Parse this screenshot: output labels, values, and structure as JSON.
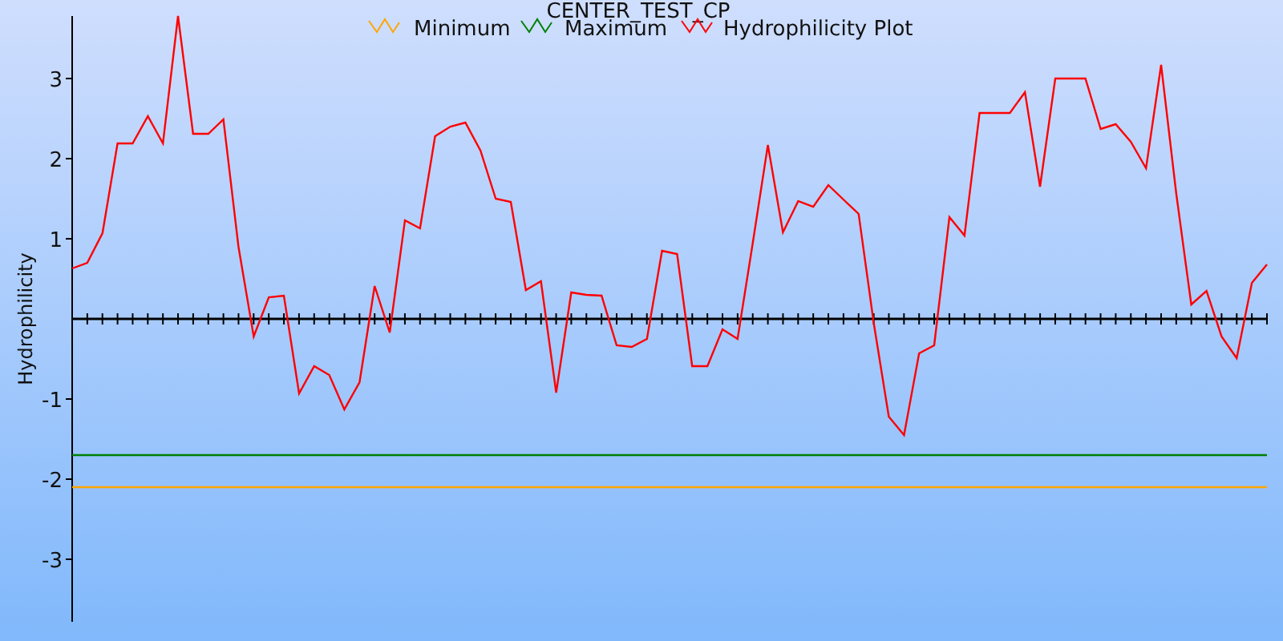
{
  "chart": {
    "chart_data": {
      "type": "line",
      "title": "CENTER_TEST_CP",
      "ylabel": "Hydrophilicity",
      "legend": true,
      "ylim": [
        -3.78,
        3.78
      ],
      "yticks": [
        {
          "value": -3,
          "label": "-3"
        },
        {
          "value": -2,
          "label": "-2"
        },
        {
          "value": -1,
          "label": "-1"
        },
        {
          "value": 1,
          "label": "1"
        },
        {
          "value": 2,
          "label": "2"
        },
        {
          "value": 3,
          "label": "3"
        }
      ],
      "series": [
        {
          "name": "Minimum",
          "color": "#ffa500",
          "values": [
            -2.1,
            -2.1,
            -2.1,
            -2.1,
            -2.1,
            -2.1,
            -2.1,
            -2.1,
            -2.1,
            -2.1,
            -2.1,
            -2.1,
            -2.1,
            -2.1,
            -2.1,
            -2.1,
            -2.1,
            -2.1,
            -2.1,
            -2.1,
            -2.1,
            -2.1,
            -2.1,
            -2.1,
            -2.1,
            -2.1,
            -2.1,
            -2.1,
            -2.1,
            -2.1,
            -2.1,
            -2.1,
            -2.1,
            -2.1,
            -2.1,
            -2.1,
            -2.1,
            -2.1,
            -2.1,
            -2.1,
            -2.1,
            -2.1,
            -2.1,
            -2.1,
            -2.1,
            -2.1,
            -2.1,
            -2.1,
            -2.1,
            -2.1,
            -2.1,
            -2.1,
            -2.1,
            -2.1,
            -2.1,
            -2.1,
            -2.1,
            -2.1,
            -2.1,
            -2.1,
            -2.1,
            -2.1,
            -2.1,
            -2.1,
            -2.1,
            -2.1,
            -2.1,
            -2.1,
            -2.1,
            -2.1,
            -2.1,
            -2.1,
            -2.1,
            -2.1,
            -2.1,
            -2.1,
            -2.1,
            -2.1,
            -2.1,
            -2.1
          ]
        },
        {
          "name": "Maximum",
          "color": "#008000",
          "values": [
            -1.7,
            -1.7,
            -1.7,
            -1.7,
            -1.7,
            -1.7,
            -1.7,
            -1.7,
            -1.7,
            -1.7,
            -1.7,
            -1.7,
            -1.7,
            -1.7,
            -1.7,
            -1.7,
            -1.7,
            -1.7,
            -1.7,
            -1.7,
            -1.7,
            -1.7,
            -1.7,
            -1.7,
            -1.7,
            -1.7,
            -1.7,
            -1.7,
            -1.7,
            -1.7,
            -1.7,
            -1.7,
            -1.7,
            -1.7,
            -1.7,
            -1.7,
            -1.7,
            -1.7,
            -1.7,
            -1.7,
            -1.7,
            -1.7,
            -1.7,
            -1.7,
            -1.7,
            -1.7,
            -1.7,
            -1.7,
            -1.7,
            -1.7,
            -1.7,
            -1.7,
            -1.7,
            -1.7,
            -1.7,
            -1.7,
            -1.7,
            -1.7,
            -1.7,
            -1.7,
            -1.7,
            -1.7,
            -1.7,
            -1.7,
            -1.7,
            -1.7,
            -1.7,
            -1.7,
            -1.7,
            -1.7,
            -1.7,
            -1.7,
            -1.7,
            -1.7,
            -1.7,
            -1.7,
            -1.7,
            -1.7,
            -1.7,
            -1.7
          ]
        },
        {
          "name": "Hydrophilicity Plot",
          "color": "#ff0000",
          "values": [
            0.63,
            0.7,
            1.07,
            2.19,
            2.19,
            2.53,
            2.19,
            3.78,
            2.31,
            2.31,
            2.49,
            0.9,
            -0.22,
            0.27,
            0.29,
            -0.93,
            -0.59,
            -0.7,
            -1.13,
            -0.79,
            0.41,
            -0.17,
            1.23,
            1.13,
            2.28,
            2.4,
            2.45,
            2.1,
            1.5,
            1.46,
            0.36,
            0.47,
            -0.92,
            0.33,
            0.3,
            0.29,
            -0.33,
            -0.35,
            -0.25,
            0.85,
            0.81,
            -0.59,
            -0.59,
            -0.13,
            -0.25,
            0.95,
            2.17,
            1.08,
            1.47,
            1.4,
            1.67,
            1.49,
            1.31,
            -0.05,
            -1.22,
            -1.45,
            -0.43,
            -0.33,
            1.27,
            1.04,
            2.57,
            2.57,
            2.57,
            2.83,
            1.65,
            3.0,
            3.0,
            3.0,
            2.37,
            2.43,
            2.21,
            1.88,
            3.17,
            1.57,
            0.18,
            0.35,
            -0.22,
            -0.49,
            0.45,
            0.68
          ]
        }
      ]
    }
  }
}
